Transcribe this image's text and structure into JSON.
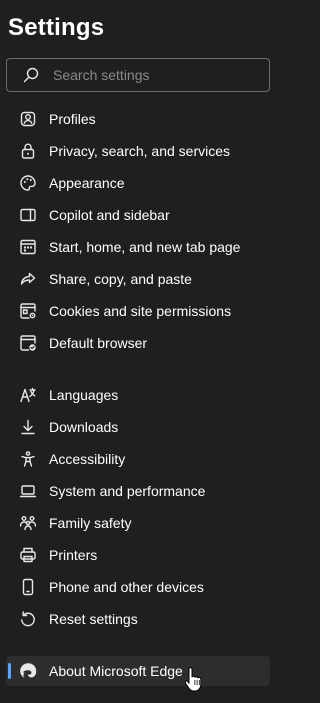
{
  "title": "Settings",
  "search": {
    "placeholder": "Search settings",
    "icon": "search-icon"
  },
  "nav": {
    "profiles": {
      "label": "Profiles",
      "icon": "profile-icon"
    },
    "privacy": {
      "label": "Privacy, search, and services",
      "icon": "lock-icon"
    },
    "appearance": {
      "label": "Appearance",
      "icon": "palette-icon"
    },
    "copilot": {
      "label": "Copilot and sidebar",
      "icon": "sidebar-icon"
    },
    "start": {
      "label": "Start, home, and new tab page",
      "icon": "home-page-icon"
    },
    "share": {
      "label": "Share, copy, and paste",
      "icon": "share-icon"
    },
    "cookies": {
      "label": "Cookies and site permissions",
      "icon": "site-permissions-icon"
    },
    "default_browser": {
      "label": "Default browser",
      "icon": "default-browser-icon"
    },
    "languages": {
      "label": "Languages",
      "icon": "languages-icon"
    },
    "downloads": {
      "label": "Downloads",
      "icon": "download-icon"
    },
    "accessibility": {
      "label": "Accessibility",
      "icon": "accessibility-icon"
    },
    "system": {
      "label": "System and performance",
      "icon": "laptop-icon"
    },
    "family": {
      "label": "Family safety",
      "icon": "family-icon"
    },
    "printers": {
      "label": "Printers",
      "icon": "printer-icon"
    },
    "phone": {
      "label": "Phone and other devices",
      "icon": "phone-icon"
    },
    "reset": {
      "label": "Reset settings",
      "icon": "reset-icon"
    },
    "about": {
      "label": "About Microsoft Edge",
      "icon": "edge-logo-icon",
      "selected": true
    }
  },
  "colors": {
    "background": "#1f1f1f",
    "selected_background": "#2d2d2d",
    "accent": "#60a5f5",
    "text": "#ffffff",
    "placeholder": "#8a8a8a",
    "border": "#6b6b6b"
  }
}
